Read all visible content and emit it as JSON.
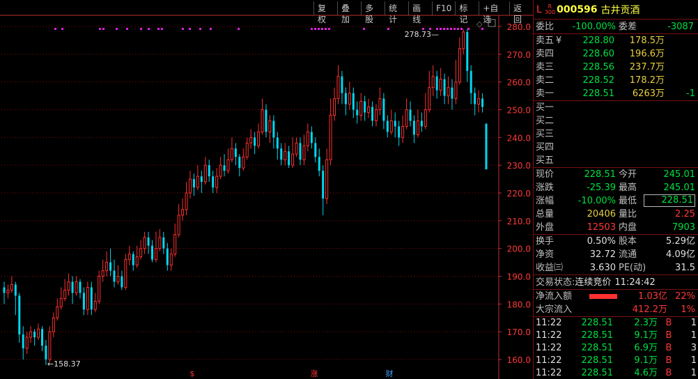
{
  "toolbar": [
    "复权",
    "叠加",
    "多股",
    "统计",
    "画线",
    "F10",
    "标记",
    "+自选",
    "返回"
  ],
  "chart_data": {
    "type": "candlestick",
    "ylim": [
      156,
      284
    ],
    "y_ticks": [
      "280.0",
      "270.0",
      "260.0",
      "250.0",
      "240.0",
      "230.0",
      "220.0",
      "210.0",
      "200.0",
      "190.0",
      "180.0",
      "170.0",
      "160.0"
    ],
    "annotations": {
      "max_label": "278.73",
      "min_label": "158.37"
    },
    "event_markers": [
      "$",
      "涨",
      "财"
    ],
    "colors": {
      "up": "#ff3030",
      "down": "#00d8f0",
      "grid": "#8a1010",
      "axis": "#c03030",
      "marker": "#e020e0"
    },
    "candles": [
      [
        186,
        184,
        188,
        180
      ],
      [
        184,
        185,
        187,
        182
      ],
      [
        185,
        187,
        190,
        184
      ],
      [
        187,
        183,
        188,
        176
      ],
      [
        183,
        169,
        184,
        166
      ],
      [
        169,
        164,
        172,
        160
      ],
      [
        164,
        168,
        170,
        162
      ],
      [
        168,
        170,
        172,
        166
      ],
      [
        170,
        168,
        171,
        165
      ],
      [
        168,
        171,
        173,
        167
      ],
      [
        171,
        165,
        172,
        163
      ],
      [
        165,
        160,
        167,
        158
      ],
      [
        160,
        170,
        172,
        159
      ],
      [
        170,
        175,
        177,
        168
      ],
      [
        175,
        179,
        182,
        174
      ],
      [
        179,
        182,
        186,
        178
      ],
      [
        182,
        185,
        189,
        181
      ],
      [
        185,
        188,
        191,
        183
      ],
      [
        188,
        184,
        190,
        180
      ],
      [
        184,
        188,
        190,
        183
      ],
      [
        188,
        184,
        189,
        182
      ],
      [
        184,
        178,
        186,
        176
      ],
      [
        178,
        186,
        188,
        176
      ],
      [
        186,
        178,
        188,
        176
      ],
      [
        178,
        181,
        184,
        177
      ],
      [
        181,
        190,
        192,
        180
      ],
      [
        190,
        192,
        196,
        188
      ],
      [
        192,
        195,
        199,
        190
      ],
      [
        195,
        192,
        200,
        190
      ],
      [
        192,
        188,
        196,
        186
      ],
      [
        188,
        190,
        194,
        187
      ],
      [
        190,
        186,
        192,
        185
      ],
      [
        186,
        196,
        198,
        185
      ],
      [
        196,
        198,
        201,
        194
      ],
      [
        198,
        194,
        199,
        192
      ],
      [
        194,
        197,
        201,
        193
      ],
      [
        197,
        200,
        203,
        196
      ],
      [
        200,
        204,
        206,
        198
      ],
      [
        204,
        201,
        206,
        198
      ],
      [
        201,
        196,
        203,
        195
      ],
      [
        196,
        200,
        206,
        195
      ],
      [
        200,
        204,
        207,
        199
      ],
      [
        204,
        200,
        206,
        198
      ],
      [
        200,
        194,
        202,
        192
      ],
      [
        194,
        198,
        200,
        192
      ],
      [
        198,
        205,
        209,
        197
      ],
      [
        205,
        212,
        216,
        204
      ],
      [
        212,
        214,
        218,
        210
      ],
      [
        214,
        220,
        224,
        212
      ],
      [
        220,
        225,
        228,
        218
      ],
      [
        225,
        222,
        227,
        219
      ],
      [
        222,
        226,
        230,
        221
      ],
      [
        226,
        224,
        228,
        220
      ],
      [
        224,
        230,
        233,
        223
      ],
      [
        230,
        226,
        232,
        224
      ],
      [
        226,
        222,
        228,
        220
      ],
      [
        222,
        226,
        229,
        220
      ],
      [
        226,
        230,
        233,
        225
      ],
      [
        230,
        228,
        234,
        226
      ],
      [
        228,
        232,
        236,
        227
      ],
      [
        232,
        236,
        240,
        231
      ],
      [
        236,
        233,
        238,
        230
      ],
      [
        233,
        229,
        234,
        226
      ],
      [
        229,
        233,
        236,
        228
      ],
      [
        233,
        238,
        240,
        232
      ],
      [
        238,
        240,
        243,
        236
      ],
      [
        240,
        237,
        242,
        234
      ],
      [
        237,
        242,
        245,
        236
      ],
      [
        242,
        250,
        254,
        241
      ],
      [
        250,
        242,
        252,
        240
      ],
      [
        242,
        246,
        248,
        238
      ],
      [
        246,
        240,
        248,
        236
      ],
      [
        240,
        236,
        242,
        232
      ],
      [
        236,
        232,
        238,
        230
      ],
      [
        232,
        235,
        238,
        230
      ],
      [
        235,
        230,
        237,
        229
      ],
      [
        230,
        234,
        240,
        229
      ],
      [
        234,
        238,
        240,
        233
      ],
      [
        238,
        232,
        240,
        230
      ],
      [
        232,
        237,
        241,
        230
      ],
      [
        237,
        242,
        245,
        235
      ],
      [
        242,
        238,
        244,
        236
      ],
      [
        238,
        233,
        240,
        231
      ],
      [
        233,
        228,
        236,
        226
      ],
      [
        228,
        218,
        230,
        212
      ],
      [
        218,
        232,
        236,
        216
      ],
      [
        232,
        248,
        254,
        230
      ],
      [
        248,
        254,
        258,
        246
      ],
      [
        254,
        262,
        266,
        252
      ],
      [
        262,
        256,
        264,
        252
      ],
      [
        256,
        252,
        258,
        248
      ],
      [
        252,
        256,
        260,
        250
      ],
      [
        256,
        250,
        258,
        247
      ],
      [
        250,
        248,
        253,
        245
      ],
      [
        248,
        253,
        256,
        246
      ],
      [
        253,
        249,
        255,
        246
      ],
      [
        249,
        251,
        254,
        247
      ],
      [
        251,
        246,
        253,
        244
      ],
      [
        246,
        250,
        252,
        244
      ],
      [
        250,
        254,
        258,
        248
      ],
      [
        254,
        246,
        256,
        243
      ],
      [
        246,
        242,
        248,
        240
      ],
      [
        242,
        246,
        250,
        241
      ],
      [
        246,
        244,
        249,
        240
      ],
      [
        244,
        240,
        246,
        237
      ],
      [
        240,
        244,
        248,
        238
      ],
      [
        244,
        250,
        254,
        243
      ],
      [
        250,
        246,
        253,
        244
      ],
      [
        246,
        241,
        248,
        238
      ],
      [
        241,
        246,
        250,
        240
      ],
      [
        246,
        244,
        249,
        242
      ],
      [
        244,
        250,
        256,
        243
      ],
      [
        250,
        258,
        264,
        249
      ],
      [
        258,
        262,
        266,
        255
      ],
      [
        262,
        257,
        264,
        254
      ],
      [
        257,
        261,
        265,
        255
      ],
      [
        261,
        255,
        263,
        252
      ],
      [
        255,
        258,
        262,
        252
      ],
      [
        258,
        254,
        261,
        250
      ],
      [
        254,
        260,
        268,
        252
      ],
      [
        260,
        272,
        276,
        259
      ],
      [
        272,
        278,
        279,
        270
      ],
      [
        278,
        264,
        279,
        260
      ],
      [
        264,
        256,
        266,
        252
      ],
      [
        256,
        252,
        258,
        248
      ],
      [
        252,
        254,
        257,
        249
      ],
      [
        254,
        251,
        256,
        249
      ],
      [
        245,
        228.51,
        245.01,
        228.51
      ]
    ]
  },
  "header": {
    "market_tag": "L",
    "r_tag": "R",
    "r_sub": "300",
    "code": "000596",
    "name": "古井贡酒"
  },
  "weibi": {
    "label1": "委比",
    "value1": "-100.00%",
    "label2": "委差",
    "value2": "-3087"
  },
  "sell": [
    {
      "label": "卖五",
      "mark": "¥",
      "price": "228.80",
      "vol": "178.5万",
      "chg": ""
    },
    {
      "label": "卖四",
      "mark": "",
      "price": "228.60",
      "vol": "196.6万",
      "chg": ""
    },
    {
      "label": "卖三",
      "mark": "",
      "price": "228.56",
      "vol": "237.7万",
      "chg": ""
    },
    {
      "label": "卖二",
      "mark": "",
      "price": "228.52",
      "vol": "178.2万",
      "chg": ""
    },
    {
      "label": "卖一",
      "mark": "",
      "price": "228.51",
      "vol": "6263万",
      "chg": "-1"
    }
  ],
  "buy": [
    "买一",
    "买二",
    "买三",
    "买四",
    "买五"
  ],
  "quote": [
    {
      "l1": "现价",
      "v1": "228.51",
      "c1": "g",
      "l2": "今开",
      "v2": "245.01",
      "c2": "g"
    },
    {
      "l1": "涨跌",
      "v1": "-25.39",
      "c1": "g",
      "l2": "最高",
      "v2": "245.01",
      "c2": "g"
    },
    {
      "l1": "涨幅",
      "v1": "-10.00%",
      "c1": "g",
      "l2": "最低",
      "v2": "228.51",
      "c2": "g"
    },
    {
      "l1": "总量",
      "v1": "20406",
      "c1": "y",
      "l2": "量比",
      "v2": "2.25",
      "c2": "r"
    },
    {
      "l1": "外盘",
      "v1": "12503",
      "c1": "r",
      "l2": "内盘",
      "v2": "7903",
      "c2": "g"
    }
  ],
  "fund": [
    {
      "l1": "换手",
      "v1": "0.50%",
      "l2": "股本",
      "v2": "5.29亿"
    },
    {
      "l1": "净资",
      "v1": "32.72",
      "l2": "流通",
      "v2": "4.09亿"
    },
    {
      "l1": "收益㈢",
      "v1": "3.630",
      "l2": "PE(动)",
      "v2": "31.5"
    }
  ],
  "status": {
    "label": "交易状态:",
    "value": "连续竞价",
    "time": "11:24:42"
  },
  "flow": [
    {
      "label": "净流入额",
      "bar": 0.84,
      "value": "1.03亿",
      "pct": "22%"
    },
    {
      "label": "大宗流入",
      "bar": 0,
      "value": "412.2万",
      "pct": "1%"
    }
  ],
  "ticks": [
    {
      "time": "11:22",
      "price": "228.51",
      "vol": "2.3万",
      "side": "B",
      "n": "1"
    },
    {
      "time": "11:22",
      "price": "228.51",
      "vol": "9.1万",
      "side": "B",
      "n": "1"
    },
    {
      "time": "11:22",
      "price": "228.51",
      "vol": "6.9万",
      "side": "B",
      "n": "3"
    },
    {
      "time": "11:22",
      "price": "228.51",
      "vol": "9.1万",
      "side": "B",
      "n": "1"
    },
    {
      "time": "11:22",
      "price": "228.51",
      "vol": "4.6万",
      "side": "B",
      "n": "1"
    }
  ]
}
